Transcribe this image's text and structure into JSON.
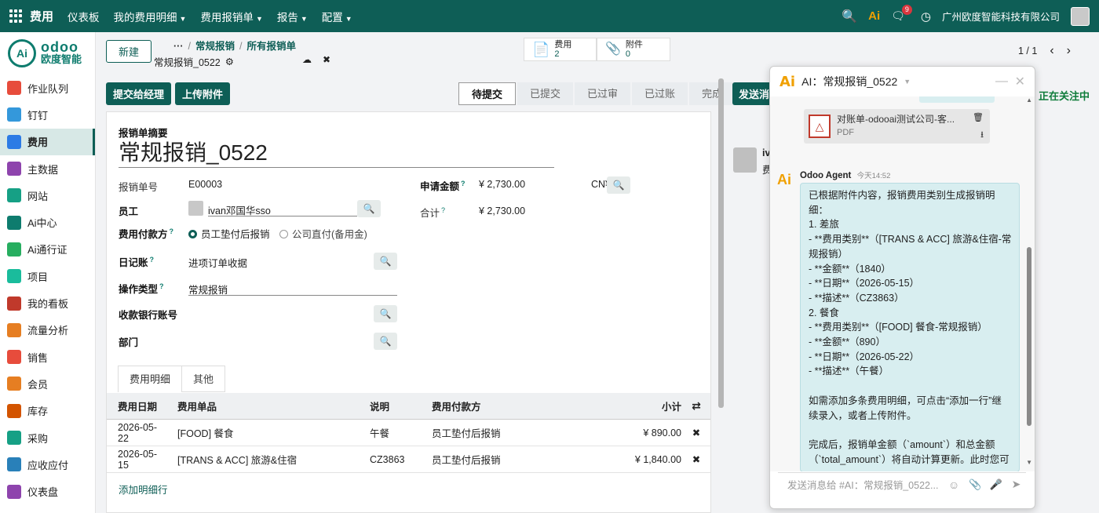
{
  "topbar": {
    "app_name": "费用",
    "menu": [
      "仪表板",
      "我的费用明细",
      "费用报销单",
      "报告",
      "配置"
    ],
    "menu_dropdown": [
      false,
      true,
      true,
      true,
      true
    ],
    "ai_label": "Ai",
    "chat_badge": "9",
    "company": "广州欧度智能科技有限公司"
  },
  "logo": {
    "circle_text": "Ai",
    "line1": "odoo",
    "line2": "欧度智能"
  },
  "sidebar": {
    "items": [
      {
        "label": "作业队列",
        "color": "#e74c3c"
      },
      {
        "label": "钉钉",
        "color": "#3498db"
      },
      {
        "label": "费用",
        "color": "#2c7be5",
        "active": true
      },
      {
        "label": "主数据",
        "color": "#8e44ad"
      },
      {
        "label": "网站",
        "color": "#16a085"
      },
      {
        "label": "Ai中心",
        "color": "#0e7c6e"
      },
      {
        "label": "Ai通行证",
        "color": "#27ae60"
      },
      {
        "label": "项目",
        "color": "#1abc9c"
      },
      {
        "label": "我的看板",
        "color": "#c0392b"
      },
      {
        "label": "流量分析",
        "color": "#e67e22"
      },
      {
        "label": "销售",
        "color": "#e74c3c"
      },
      {
        "label": "会员",
        "color": "#e67e22"
      },
      {
        "label": "库存",
        "color": "#d35400"
      },
      {
        "label": "采购",
        "color": "#16a085"
      },
      {
        "label": "应收应付",
        "color": "#2980b9"
      },
      {
        "label": "仪表盘",
        "color": "#8e44ad"
      }
    ]
  },
  "control_panel": {
    "new_button": "新建",
    "breadcrumb_ellipsis": "···",
    "breadcrumbs": [
      "常规报销",
      "所有报销单"
    ],
    "record_name": "常规报销_0522",
    "stat_expense_label": "费用",
    "stat_expense_count": "2",
    "stat_attach_label": "附件",
    "stat_attach_count": "0",
    "pager": "1 / 1"
  },
  "actions": {
    "submit_manager": "提交给经理",
    "upload_attachment": "上传附件",
    "send_message": "发送消",
    "following": "正在关注中"
  },
  "statusbar": {
    "stages": [
      "待提交",
      "已提交",
      "已过审",
      "已过账",
      "完成"
    ],
    "current": "待提交"
  },
  "form": {
    "summary_label": "报销单摘要",
    "title": "常规报销_0522",
    "number_label": "报销单号",
    "number_value": "E00003",
    "employee_label": "员工",
    "employee_value": "ivan邓国华sso",
    "payer_label": "费用付款方",
    "payer_opt1": "员工垫付后报销",
    "payer_opt2": "公司直付(备用金)",
    "journal_label": "日记账",
    "journal_value": "进项订单收据",
    "optype_label": "操作类型",
    "optype_value": "常规报销",
    "bank_label": "收款银行账号",
    "dept_label": "部门",
    "amount_label": "申请金额",
    "amount_value": "¥ 2,730.00",
    "currency": "CN¥",
    "total_label": "合计",
    "total_value": "¥ 2,730.00"
  },
  "tabs": [
    "费用明细",
    "其他"
  ],
  "lines": {
    "headers": [
      "费用日期",
      "费用单品",
      "说明",
      "费用付款方",
      "小计"
    ],
    "rows": [
      {
        "date": "2026-05-22",
        "product": "[FOOD] 餐食",
        "desc": "午餐",
        "payer": "员工垫付后报销",
        "subtotal": "¥ 890.00"
      },
      {
        "date": "2026-05-15",
        "product": "[TRANS & ACC] 旅游&住宿",
        "desc": "CZ3863",
        "payer": "员工垫付后报销",
        "subtotal": "¥ 1,840.00"
      }
    ],
    "add_line": "添加明细行"
  },
  "chatter_peek": {
    "name": "iv",
    "snippet": "费"
  },
  "ai_panel": {
    "title": "AI：常规报销_0522",
    "pdf_name": "对账单-odooai测试公司-客...",
    "pdf_type": "PDF",
    "agent_name": "Odoo Agent",
    "agent_time": "今天14:52",
    "message_lines": [
      "已根据附件内容，报销费用类别生成报销明",
      "细：",
      "1. 差旅",
      "- **费用类别**（[TRANS & ACC] 旅游&住宿-常",
      "规报销）",
      "- **金额**（1840）",
      "- **日期**（2026-05-15）",
      "- **描述**（CZ3863）",
      "2. 餐食",
      "- **费用类别**（[FOOD] 餐食-常规报销）",
      "- **金额**（890）",
      "- **日期**（2026-05-22）",
      "- **描述**（午餐）",
      "",
      "如需添加多条费用明细，可点击“添加一行”继",
      "续录入，或者上传附件。",
      "",
      "完成后，报销单金额（`amount`）和总金额",
      "（`total_amount`）将自动计算更新。此时您可"
    ],
    "input_placeholder": "发送消息给 #AI：常规报销_0522..."
  }
}
